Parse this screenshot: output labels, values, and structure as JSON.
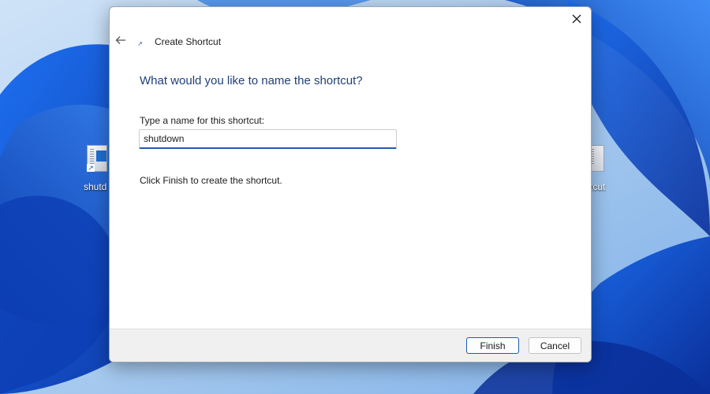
{
  "wizard": {
    "title": "Create Shortcut",
    "heading": "What would you like to name the shortcut?",
    "name_label": "Type a name for this shortcut:",
    "name_value": "shutdown",
    "hint": "Click Finish to create the shortcut.",
    "finish_label": "Finish",
    "cancel_label": "Cancel",
    "back_icon": "back-arrow-icon",
    "close_icon": "close-icon"
  },
  "desktop": {
    "icons": [
      {
        "label": "shutd",
        "icon": "shortcut-icon"
      },
      {
        "label": "rtcut",
        "icon": "shortcut-icon"
      }
    ]
  },
  "colors": {
    "accent": "#1e5bb5",
    "heading": "#1f3f7a",
    "wallpaper_base": "#0b3fb3"
  }
}
